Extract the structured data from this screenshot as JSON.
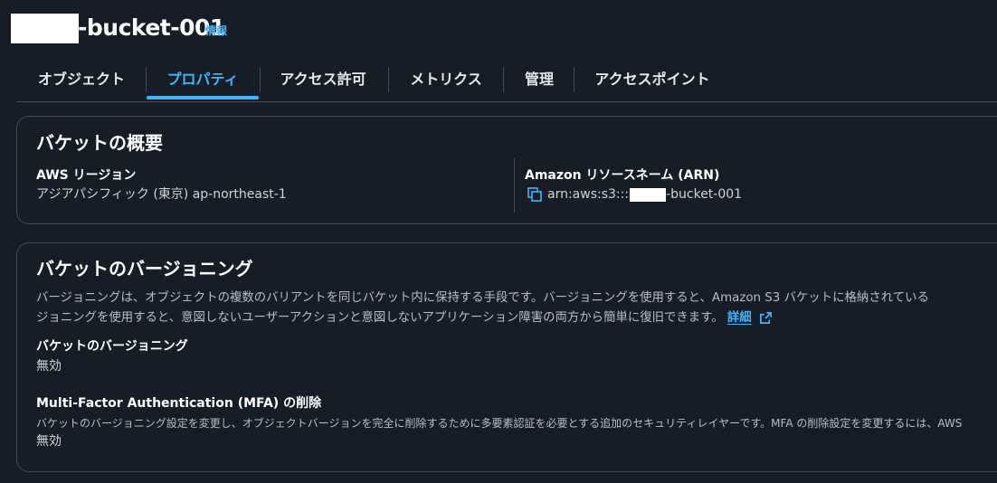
{
  "header": {
    "bucket_name": "-bucket-001",
    "info_label": "情報"
  },
  "tabs": [
    {
      "label": "オブジェクト",
      "active": false
    },
    {
      "label": "プロパティ",
      "active": true
    },
    {
      "label": "アクセス許可",
      "active": false
    },
    {
      "label": "メトリクス",
      "active": false
    },
    {
      "label": "管理",
      "active": false
    },
    {
      "label": "アクセスポイント",
      "active": false
    }
  ],
  "overview": {
    "heading": "バケットの概要",
    "region_label": "AWS リージョン",
    "region_value": "アジアパシフィック (東京) ap-northeast-1",
    "arn_label": "Amazon リソースネーム (ARN)",
    "arn_prefix": "arn:aws:s3:::",
    "arn_suffix": "-bucket-001",
    "copy_icon": "copy-icon"
  },
  "versioning": {
    "heading": "バケットのバージョニング",
    "description_line1": "バージョニングは、オブジェクトの複数のバリアントを同じバケット内に保持する手段です。バージョニングを使用すると、Amazon S3 バケットに格納されている",
    "description_line2": "ジョニングを使用すると、意図しないユーザーアクションと意図しないアプリケーション障害の両方から簡単に復旧できます。",
    "detail_link": "詳細",
    "external_icon": "external-link-icon",
    "status_label": "バケットのバージョニング",
    "status_value": "無効",
    "mfa_label": "Multi-Factor Authentication (MFA) の削除",
    "mfa_description": "バケットのバージョニング設定を変更し、オブジェクトバージョンを完全に削除するために多要素認証を必要とする追加のセキュリティレイヤーです。MFA の削除設定を変更するには、AWS",
    "mfa_value": "無効"
  },
  "colors": {
    "background": "#161d26",
    "accent": "#42b4ff",
    "border": "#414d5c"
  }
}
